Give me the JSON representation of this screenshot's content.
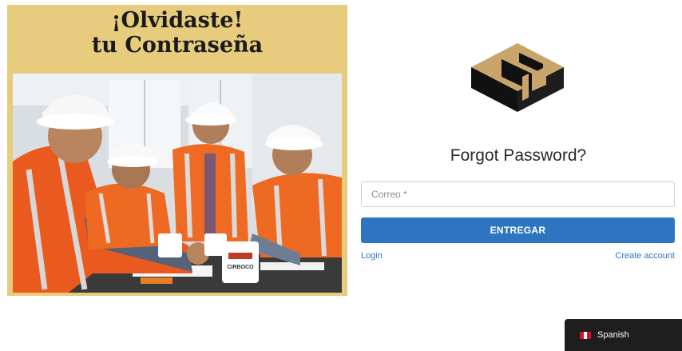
{
  "banner": {
    "title_line1": "¡Olvidaste!",
    "title_line2": "tu Contraseña",
    "background_color": "#e6cc7c",
    "mug_text": "CIRBOCO"
  },
  "form": {
    "title": "Forgot Password?",
    "email_placeholder": "Correo *",
    "email_value": "",
    "submit_label": "ENTREGAR",
    "login_link": "Login",
    "create_account_link": "Create account",
    "accent_color": "#2d75c0"
  },
  "language": {
    "selected": "Spanish",
    "flag_icon": "peru-flag-icon"
  }
}
